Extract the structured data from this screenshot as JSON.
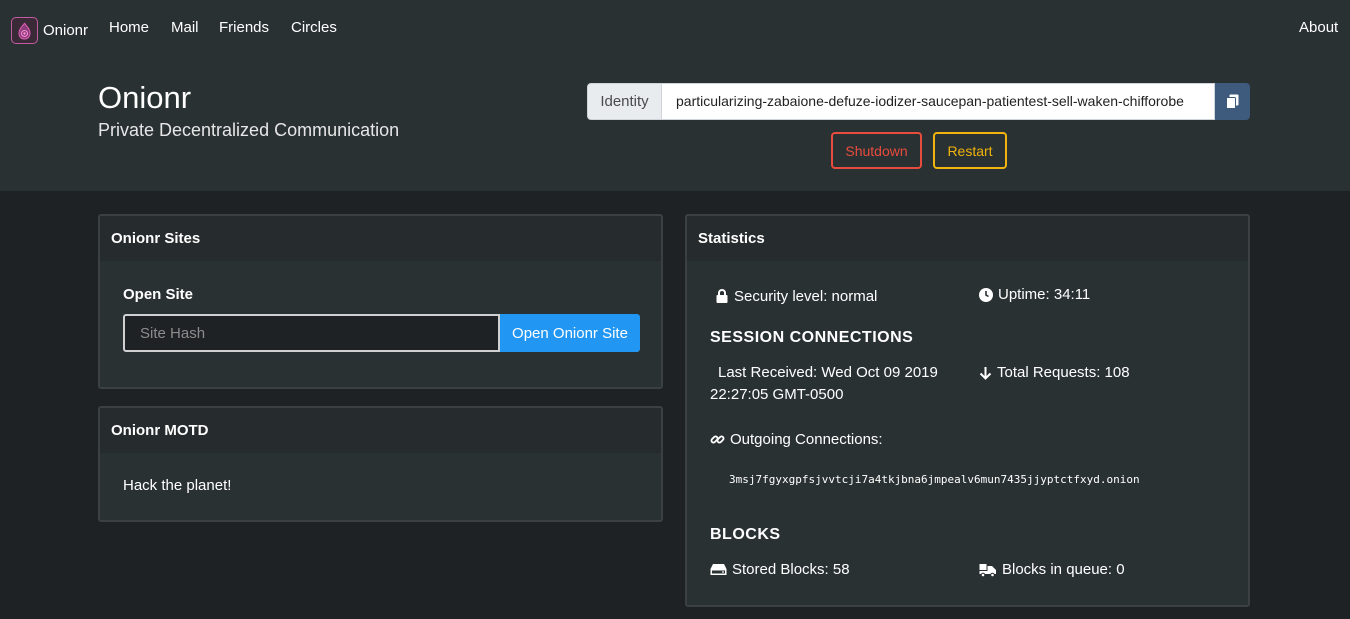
{
  "nav": {
    "brand": "Onionr",
    "items": [
      "Home",
      "Mail",
      "Friends",
      "Circles"
    ],
    "about": "About"
  },
  "hero": {
    "title": "Onionr",
    "subtitle": "Private Decentralized Communication",
    "identity_label": "Identity",
    "identity_value": "particularizing-zabaione-defuze-iodizer-saucepan-patientest-sell-waken-chifforobe",
    "shutdown": "Shutdown",
    "restart": "Restart"
  },
  "sites": {
    "header": "Onionr Sites",
    "open_site_label": "Open Site",
    "hash_placeholder": "Site Hash",
    "open_button": "Open Onionr Site"
  },
  "motd": {
    "header": "Onionr MOTD",
    "text": "Hack the planet!"
  },
  "stats": {
    "header": "Statistics",
    "security": "Security level: normal",
    "uptime": "Uptime: 34:11",
    "session_title": "SESSION CONNECTIONS",
    "last_received_1": "Last Received: Wed Oct 09 2019",
    "last_received_2": "22:27:05 GMT-0500",
    "total_requests": "Total Requests: 108",
    "outgoing": "Outgoing Connections:",
    "outgoing_address": "3msj7fgyxgpfsjvvtcji7a4tkjbna6jmpealv6mun7435jjyptctfxyd.onion",
    "blocks_title": "BLOCKS",
    "stored_blocks": "Stored Blocks: 58",
    "blocks_queue": "Blocks in queue: 0"
  },
  "colors": {
    "primary": "#2196f3",
    "danger": "#e84c3d",
    "warning": "#f1b30d",
    "copy": "#3e5b7d"
  }
}
